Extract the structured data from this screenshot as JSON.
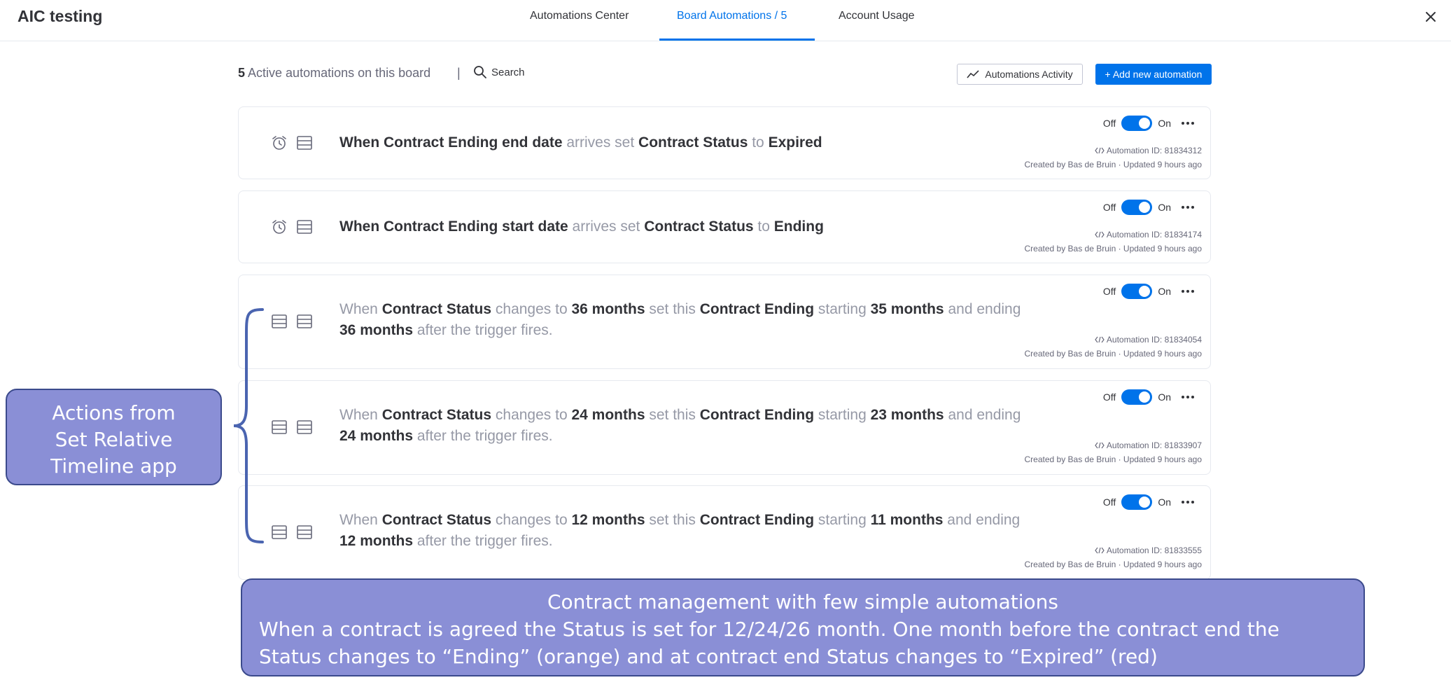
{
  "app": {
    "title": "AIC testing"
  },
  "tabs": [
    {
      "label": "Automations Center"
    },
    {
      "label": "Board Automations / 5"
    },
    {
      "label": "Account Usage"
    }
  ],
  "toolbar": {
    "count": "5",
    "count_text": " Active automations on this board",
    "divider": "|",
    "search_label": "Search",
    "activity_label": "Automations Activity",
    "add_label": "+ Add new automation"
  },
  "toggle": {
    "off_label": "Off",
    "on_label": "On"
  },
  "automations": [
    {
      "icons": [
        "alarm-clock-icon",
        "table-icon"
      ],
      "sentence": [
        {
          "t": "When Contract Ending end date",
          "b": true
        },
        {
          "t": " arrives set ",
          "b": false
        },
        {
          "t": "Contract Status",
          "b": true
        },
        {
          "t": " to ",
          "b": false
        },
        {
          "t": "Expired",
          "b": true
        }
      ],
      "id_line": "Automation ID: 81834312",
      "created_line": "Created by Bas de Bruin · Updated 9 hours ago"
    },
    {
      "icons": [
        "alarm-clock-icon",
        "table-icon"
      ],
      "sentence": [
        {
          "t": "When Contract Ending start date",
          "b": true
        },
        {
          "t": " arrives set ",
          "b": false
        },
        {
          "t": "Contract Status",
          "b": true
        },
        {
          "t": " to ",
          "b": false
        },
        {
          "t": "Ending",
          "b": true
        }
      ],
      "id_line": "Automation ID: 81834174",
      "created_line": "Created by Bas de Bruin · Updated 9 hours ago"
    },
    {
      "icons": [
        "table-icon",
        "table-icon"
      ],
      "sentence": [
        {
          "t": "When ",
          "b": false
        },
        {
          "t": "Contract Status",
          "b": true
        },
        {
          "t": " changes to ",
          "b": false
        },
        {
          "t": "36 months",
          "b": true
        },
        {
          "t": " set this ",
          "b": false
        },
        {
          "t": "Contract Ending",
          "b": true
        },
        {
          "t": " starting ",
          "b": false
        },
        {
          "t": "35 months",
          "b": true
        },
        {
          "t": " and ending",
          "b": false
        },
        {
          "t": "36 months",
          "b": true,
          "br": true
        },
        {
          "t": " after the trigger fires.",
          "b": false
        }
      ],
      "id_line": "Automation ID: 81834054",
      "created_line": "Created by Bas de Bruin · Updated 9 hours ago"
    },
    {
      "icons": [
        "table-icon",
        "table-icon"
      ],
      "sentence": [
        {
          "t": "When ",
          "b": false
        },
        {
          "t": "Contract Status",
          "b": true
        },
        {
          "t": " changes to ",
          "b": false
        },
        {
          "t": "24 months",
          "b": true
        },
        {
          "t": " set this ",
          "b": false
        },
        {
          "t": "Contract Ending",
          "b": true
        },
        {
          "t": " starting ",
          "b": false
        },
        {
          "t": "23 months",
          "b": true
        },
        {
          "t": " and ending",
          "b": false
        },
        {
          "t": "24 months",
          "b": true,
          "br": true
        },
        {
          "t": " after the trigger fires.",
          "b": false
        }
      ],
      "id_line": "Automation ID: 81833907",
      "created_line": "Created by Bas de Bruin · Updated 9 hours ago"
    },
    {
      "icons": [
        "table-icon",
        "table-icon"
      ],
      "sentence": [
        {
          "t": "When ",
          "b": false
        },
        {
          "t": "Contract Status",
          "b": true
        },
        {
          "t": " changes to ",
          "b": false
        },
        {
          "t": "12 months",
          "b": true
        },
        {
          "t": " set this ",
          "b": false
        },
        {
          "t": "Contract Ending",
          "b": true
        },
        {
          "t": " starting ",
          "b": false
        },
        {
          "t": "11 months",
          "b": true
        },
        {
          "t": " and ending",
          "b": false
        },
        {
          "t": "12 months",
          "b": true,
          "br": true
        },
        {
          "t": " after the trigger fires.",
          "b": false
        }
      ],
      "id_line": "Automation ID: 81833555",
      "created_line": "Created by Bas de Bruin · Updated 9 hours ago"
    }
  ],
  "annotations": {
    "side_lines": [
      "Actions from",
      "Set Relative",
      "Timeline app"
    ],
    "bottom_title": "Contract management with few simple automations",
    "bottom_body": "When a contract is agreed the Status is set for 12/24/26 month. One month before the contract end the Status changes to “Ending” (orange) and at contract end Status changes to “Expired” (red)"
  },
  "colors": {
    "accent": "#0073ea",
    "callout_fill": "#8a8fd6",
    "callout_border": "#3b4a8c",
    "brace": "#4a64b0"
  }
}
